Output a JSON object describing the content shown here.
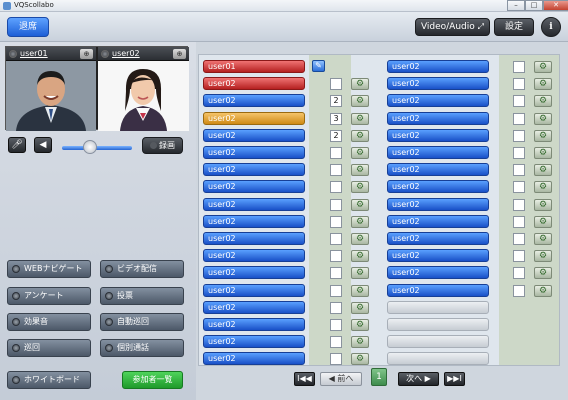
{
  "window": {
    "title": "VQScollabo",
    "minimize": "–",
    "maximize": "□",
    "close": "✕"
  },
  "topbar": {
    "exit_label": "退席",
    "video_audio_label": "Video/Audio",
    "settings_label": "設定",
    "info_label": "i"
  },
  "video": {
    "left": {
      "name": "user01"
    },
    "right": {
      "name": "user02"
    }
  },
  "controls": {
    "record_label": "録画",
    "volume_level": 0.4
  },
  "functions": {
    "web_navigate": "WEBナビゲート",
    "video_stream": "ビデオ配信",
    "survey": "アンケート",
    "vote": "投票",
    "sound_effect": "効果音",
    "auto_patrol": "自動巡回",
    "patrol": "巡回",
    "private_call": "個別通話",
    "whiteboard": "ホワイトボード",
    "participants": "参加者一覧"
  },
  "participants_left": [
    {
      "name": "user01",
      "color": "red",
      "number": "",
      "edit": true
    },
    {
      "name": "user02",
      "color": "red",
      "number": ""
    },
    {
      "name": "user02",
      "color": "blue",
      "number": "2"
    },
    {
      "name": "user02",
      "color": "orange",
      "number": "3"
    },
    {
      "name": "user02",
      "color": "blue",
      "number": "2"
    },
    {
      "name": "user02",
      "color": "blue",
      "number": ""
    },
    {
      "name": "user02",
      "color": "blue",
      "number": ""
    },
    {
      "name": "user02",
      "color": "blue",
      "number": ""
    },
    {
      "name": "user02",
      "color": "blue",
      "number": ""
    },
    {
      "name": "user02",
      "color": "blue",
      "number": ""
    },
    {
      "name": "user02",
      "color": "blue",
      "number": ""
    },
    {
      "name": "user02",
      "color": "blue",
      "number": ""
    },
    {
      "name": "user02",
      "color": "blue",
      "number": ""
    },
    {
      "name": "user02",
      "color": "blue",
      "number": ""
    },
    {
      "name": "user02",
      "color": "blue",
      "number": ""
    },
    {
      "name": "user02",
      "color": "blue",
      "number": ""
    },
    {
      "name": "user02",
      "color": "blue",
      "number": ""
    },
    {
      "name": "user02",
      "color": "blue",
      "number": ""
    }
  ],
  "participants_right": [
    {
      "name": "user02"
    },
    {
      "name": "user02"
    },
    {
      "name": "user02"
    },
    {
      "name": "user02"
    },
    {
      "name": "user02"
    },
    {
      "name": "user02"
    },
    {
      "name": "user02"
    },
    {
      "name": "user02"
    },
    {
      "name": "user02"
    },
    {
      "name": "user02"
    },
    {
      "name": "user02"
    },
    {
      "name": "user02"
    },
    {
      "name": "user02"
    },
    {
      "name": "user02"
    },
    {
      "name": ""
    },
    {
      "name": ""
    },
    {
      "name": ""
    },
    {
      "name": ""
    }
  ],
  "pager": {
    "first": "I◀◀",
    "prev": "◀ 前へ",
    "page": "1",
    "next": "次へ ▶",
    "last": "▶▶I"
  }
}
